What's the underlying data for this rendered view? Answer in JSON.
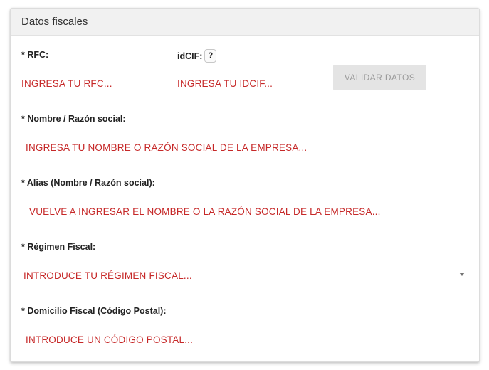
{
  "card": {
    "title": "Datos fiscales"
  },
  "rfc": {
    "label": "* RFC:",
    "placeholder": "INGRESA TU RFC..."
  },
  "idcif": {
    "label": "idCIF:",
    "help_symbol": "?",
    "placeholder": "INGRESA TU IDCIF..."
  },
  "validate_button": {
    "label": "VALIDAR DATOS"
  },
  "nombre": {
    "label": "* Nombre / Razón social:",
    "placeholder": "INGRESA TU NOMBRE O RAZÓN SOCIAL DE LA EMPRESA..."
  },
  "alias": {
    "label": "* Alias (Nombre / Razón social):",
    "placeholder": "VUELVE A INGRESAR EL NOMBRE O LA RAZÓN SOCIAL DE LA EMPRESA..."
  },
  "regimen": {
    "label": "* Régimen Fiscal:",
    "placeholder": "INTRODUCE TU RÉGIMEN FISCAL...",
    "icon": "dropdown-arrow-icon"
  },
  "domicilio": {
    "label": "* Domicilio Fiscal (Código Postal):",
    "placeholder": "INTRODUCE UN CÓDIGO POSTAL..."
  },
  "colors": {
    "placeholder_red": "#c62828",
    "header_bg": "#f1f1f1",
    "button_bg": "#e4e4e4",
    "button_text": "#9a9a9a"
  }
}
